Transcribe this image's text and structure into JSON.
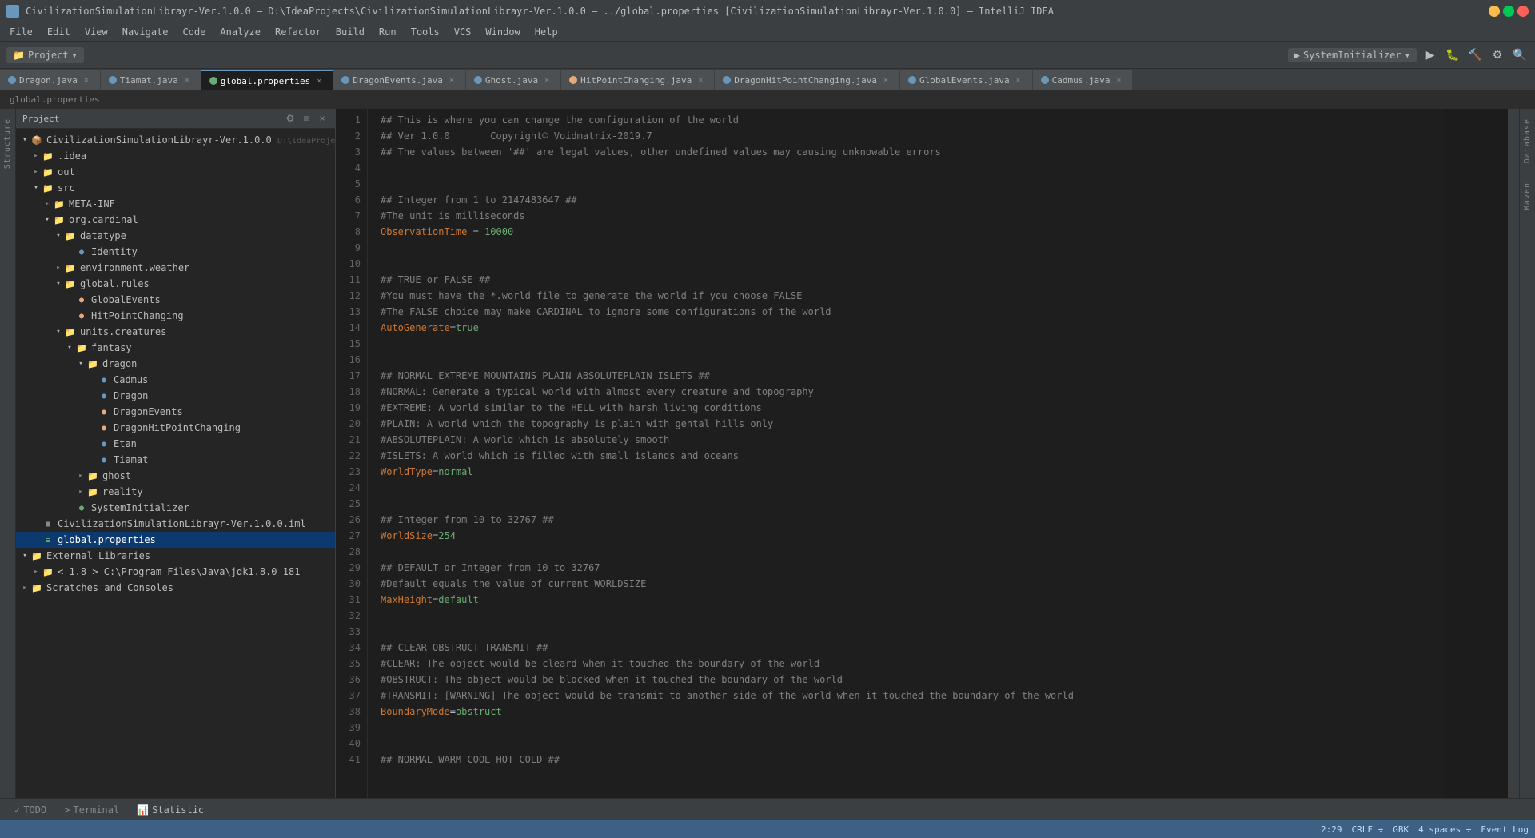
{
  "titleBar": {
    "title": "CivilizationSimulationLibrayr-Ver.1.0.0 – D:\\IdeaProjects\\CivilizationSimulationLibrayr-Ver.1.0.0 – ../global.properties [CivilizationSimulationLibrayr-Ver.1.0.0] – IntelliJ IDEA",
    "projectName": "CivilizationSimulationLibrayr-Ver.1.0.0",
    "filePath": "D:\\IdeaProjects\\CivilizationSimulationLibrayr-Ver.1.0.0"
  },
  "menuBar": {
    "items": [
      "File",
      "Edit",
      "View",
      "Navigate",
      "Code",
      "Analyze",
      "Refactor",
      "Build",
      "Run",
      "Tools",
      "VCS",
      "Window",
      "Help"
    ]
  },
  "toolbar": {
    "projectLabel": "Project",
    "filePathLabel": "global.properties",
    "runConfig": "SystemInitializer",
    "searchLabel": ""
  },
  "tabs": [
    {
      "label": "Dragon.java",
      "color": "#6897bb",
      "active": false
    },
    {
      "label": "Tiamat.java",
      "color": "#6897bb",
      "active": false
    },
    {
      "label": "global.properties",
      "color": "#6aab73",
      "active": true
    },
    {
      "label": "DragonEvents.java",
      "color": "#6897bb",
      "active": false
    },
    {
      "label": "Ghost.java",
      "color": "#6897bb",
      "active": false
    },
    {
      "label": "HitPointChanging.java",
      "color": "#e8a87c",
      "active": false
    },
    {
      "label": "DragonHitPointChanging.java",
      "color": "#6897bb",
      "active": false
    },
    {
      "label": "GlobalEvents.java",
      "color": "#6897bb",
      "active": false
    },
    {
      "label": "Cadmus.java",
      "color": "#6897bb",
      "active": false
    }
  ],
  "breadcrumb": {
    "parts": [
      "global.properties"
    ]
  },
  "sidebar": {
    "title": "Project",
    "projectRoot": "CivilizationSimulationLibrayr-Ver.1.0.0",
    "projectPath": "D:\\IdeaProjects\\CivilizationSimulationLibr...",
    "tree": [
      {
        "level": 0,
        "type": "project",
        "label": "CivilizationSimulationLibrayr-Ver.1.0.0",
        "extra": "D:\\IdeaProjects\\CivilizationSimulationLibr...",
        "open": true
      },
      {
        "level": 1,
        "type": "folder",
        "label": ".idea",
        "open": false
      },
      {
        "level": 1,
        "type": "folder",
        "label": "out",
        "open": false
      },
      {
        "level": 1,
        "type": "folder-open",
        "label": "src",
        "open": true
      },
      {
        "level": 2,
        "type": "folder",
        "label": "META-INF",
        "open": false
      },
      {
        "level": 2,
        "type": "folder-open",
        "label": "org.cardinal",
        "open": true
      },
      {
        "level": 3,
        "type": "folder-open",
        "label": "datatype",
        "open": true
      },
      {
        "level": 4,
        "type": "class",
        "label": "Identity",
        "open": false
      },
      {
        "level": 3,
        "type": "folder",
        "label": "environment.weather",
        "open": false
      },
      {
        "level": 3,
        "type": "folder-open",
        "label": "global.rules",
        "open": true
      },
      {
        "level": 4,
        "type": "class-orange",
        "label": "GlobalEvents",
        "open": false
      },
      {
        "level": 4,
        "type": "class-orange",
        "label": "HitPointChanging",
        "open": false
      },
      {
        "level": 3,
        "type": "folder-open",
        "label": "units.creatures",
        "open": true
      },
      {
        "level": 4,
        "type": "folder-open",
        "label": "fantasy",
        "open": true
      },
      {
        "level": 5,
        "type": "folder-open",
        "label": "dragon",
        "open": true
      },
      {
        "level": 6,
        "type": "class",
        "label": "Cadmus",
        "open": false
      },
      {
        "level": 6,
        "type": "class",
        "label": "Dragon",
        "open": false
      },
      {
        "level": 6,
        "type": "class-orange",
        "label": "DragonEvents",
        "open": false
      },
      {
        "level": 6,
        "type": "class-orange",
        "label": "DragonHitPointChanging",
        "open": false
      },
      {
        "level": 6,
        "type": "class",
        "label": "Etan",
        "open": false
      },
      {
        "level": 6,
        "type": "class",
        "label": "Tiamat",
        "open": false
      },
      {
        "level": 5,
        "type": "folder",
        "label": "ghost",
        "open": false
      },
      {
        "level": 5,
        "type": "folder",
        "label": "reality",
        "open": false
      },
      {
        "level": 4,
        "type": "class-green",
        "label": "SystemInitializer",
        "open": false
      },
      {
        "level": 1,
        "type": "iml",
        "label": "CivilizationSimulationLibrayr-Ver.1.0.0.iml",
        "open": false
      },
      {
        "level": 1,
        "type": "properties-sel",
        "label": "global.properties",
        "open": false,
        "selected": true
      },
      {
        "level": 0,
        "type": "folder-ext",
        "label": "External Libraries",
        "open": true
      },
      {
        "level": 1,
        "type": "folder",
        "label": "< 1.8 > C:\\Program Files\\Java\\jdk1.8.0_181",
        "open": false
      },
      {
        "level": 0,
        "type": "folder",
        "label": "Scratches and Consoles",
        "open": false
      }
    ]
  },
  "editor": {
    "filename": "global.properties",
    "lines": [
      {
        "num": 1,
        "text": "## This is where you can change the configuration of the world",
        "type": "comment"
      },
      {
        "num": 2,
        "text": "## Ver 1.0.0       Copyright© Voidmatrix-2019.7",
        "type": "comment"
      },
      {
        "num": 3,
        "text": "## The values between '##' are legal values, other undefined values may causing unknowable errors",
        "type": "comment"
      },
      {
        "num": 4,
        "text": "",
        "type": "normal"
      },
      {
        "num": 5,
        "text": "",
        "type": "normal"
      },
      {
        "num": 6,
        "text": "## Integer from 1 to 2147483647 ##",
        "type": "comment"
      },
      {
        "num": 7,
        "text": "#The unit is milliseconds",
        "type": "comment"
      },
      {
        "num": 8,
        "text": "ObservationTime = 10000",
        "type": "keyvalue",
        "key": "ObservationTime",
        "sep": " = ",
        "val": "10000"
      },
      {
        "num": 9,
        "text": "",
        "type": "normal"
      },
      {
        "num": 10,
        "text": "",
        "type": "normal"
      },
      {
        "num": 11,
        "text": "## TRUE or FALSE ##",
        "type": "comment"
      },
      {
        "num": 12,
        "text": "#You must have the *.world file to generate the world if you choose FALSE",
        "type": "comment"
      },
      {
        "num": 13,
        "text": "#The FALSE choice may make CARDINAL to ignore some configurations of the world",
        "type": "comment"
      },
      {
        "num": 14,
        "text": "AutoGenerate=true",
        "type": "keyvalue",
        "key": "AutoGenerate",
        "sep": "=",
        "val": "true"
      },
      {
        "num": 15,
        "text": "",
        "type": "normal"
      },
      {
        "num": 16,
        "text": "",
        "type": "normal"
      },
      {
        "num": 17,
        "text": "## NORMAL EXTREME MOUNTAINS PLAIN ABSOLUTEPLAIN ISLETS ##",
        "type": "comment"
      },
      {
        "num": 18,
        "text": "#NORMAL: Generate a typical world with almost every creature and topography",
        "type": "comment"
      },
      {
        "num": 19,
        "text": "#EXTREME: A world similar to the HELL with harsh living conditions",
        "type": "comment"
      },
      {
        "num": 20,
        "text": "#PLAIN: A world which the topography is plain with gental hills only",
        "type": "comment"
      },
      {
        "num": 21,
        "text": "#ABSOLUTEPLAIN: A world which is absolutely smooth",
        "type": "comment"
      },
      {
        "num": 22,
        "text": "#ISLETS: A world which is filled with small islands and oceans",
        "type": "comment"
      },
      {
        "num": 23,
        "text": "WorldType=normal",
        "type": "keyvalue",
        "key": "WorldType",
        "sep": "=",
        "val": "normal"
      },
      {
        "num": 24,
        "text": "",
        "type": "normal"
      },
      {
        "num": 25,
        "text": "",
        "type": "normal"
      },
      {
        "num": 26,
        "text": "## Integer from 10 to 32767 ##",
        "type": "comment"
      },
      {
        "num": 27,
        "text": "WorldSize=254",
        "type": "keyvalue",
        "key": "WorldSize",
        "sep": "=",
        "val": "254"
      },
      {
        "num": 28,
        "text": "",
        "type": "normal"
      },
      {
        "num": 29,
        "text": "## DEFAULT or Integer from 10 to 32767",
        "type": "comment"
      },
      {
        "num": 30,
        "text": "#Default equals the value of current WORLDSIZE",
        "type": "comment"
      },
      {
        "num": 31,
        "text": "MaxHeight=default",
        "type": "keyvalue",
        "key": "MaxHeight",
        "sep": "=",
        "val": "default"
      },
      {
        "num": 32,
        "text": "",
        "type": "normal"
      },
      {
        "num": 33,
        "text": "",
        "type": "normal"
      },
      {
        "num": 34,
        "text": "## CLEAR OBSTRUCT TRANSMIT ##",
        "type": "comment"
      },
      {
        "num": 35,
        "text": "#CLEAR: The object would be cleard when it touched the boundary of the world",
        "type": "comment"
      },
      {
        "num": 36,
        "text": "#OBSTRUCT: The object would be blocked when it touched the boundary of the world",
        "type": "comment"
      },
      {
        "num": 37,
        "text": "#TRANSMIT: [WARNING] The object would be transmit to another side of the world when it touched the boundary of the world",
        "type": "comment"
      },
      {
        "num": 38,
        "text": "BoundaryMode=obstruct",
        "type": "keyvalue",
        "key": "BoundaryMode",
        "sep": "=",
        "val": "obstruct"
      },
      {
        "num": 39,
        "text": "",
        "type": "normal"
      },
      {
        "num": 40,
        "text": "",
        "type": "normal"
      },
      {
        "num": 41,
        "text": "## NORMAL WARM COOL HOT COLD ##",
        "type": "comment"
      }
    ]
  },
  "bottomTabs": [
    {
      "label": "TODO",
      "icon": "✓"
    },
    {
      "label": "Terminal",
      "icon": ">"
    },
    {
      "label": "Statistic",
      "icon": "📊"
    }
  ],
  "statusBar": {
    "position": "2:29",
    "lineEnding": "CRLF ÷",
    "encoding": "GBK",
    "indent": "4 spaces ÷",
    "eventLog": "Event Log"
  },
  "verticalTabs": {
    "left": [
      "Structure"
    ],
    "right": [
      "Database",
      "Maven"
    ]
  }
}
